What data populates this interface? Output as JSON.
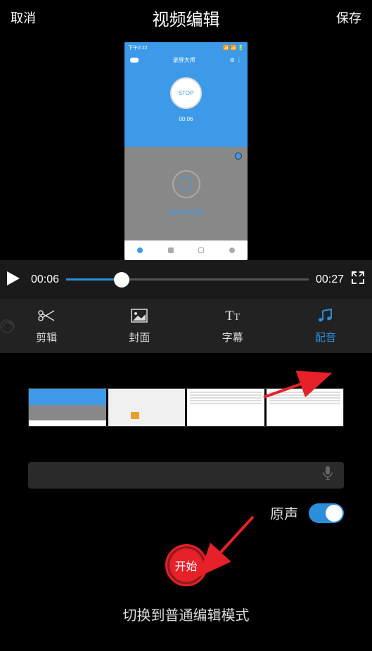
{
  "header": {
    "cancel": "取消",
    "title": "视频编辑",
    "save": "保存"
  },
  "preview": {
    "status_left": "下午2:22",
    "app_title": "录屏大师",
    "stop_label": "STOP",
    "timer": "00:06",
    "bottom_text": "使屏游戏录制"
  },
  "playback": {
    "current": "00:06",
    "total": "00:27"
  },
  "tabs": [
    {
      "label": "剪辑",
      "icon": "scissors"
    },
    {
      "label": "封面",
      "icon": "image"
    },
    {
      "label": "字幕",
      "icon": "text"
    },
    {
      "label": "配音",
      "icon": "music"
    }
  ],
  "audio": {
    "original_label": "原声",
    "original_on": true
  },
  "start_btn": "开始",
  "mode_switch": "切换到普通编辑模式"
}
